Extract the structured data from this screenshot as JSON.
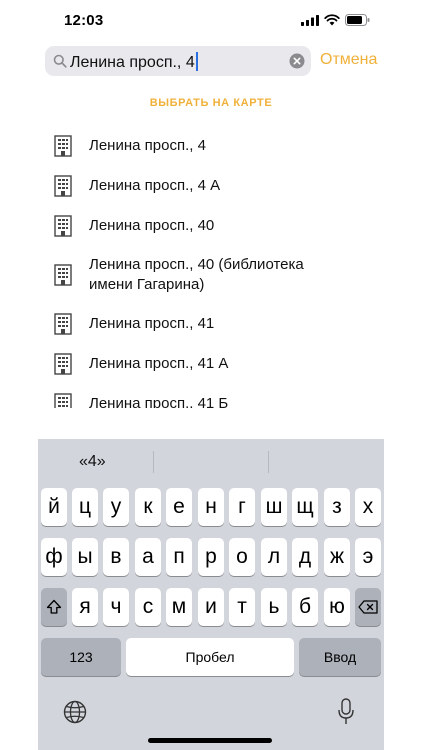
{
  "status_bar": {
    "time": "12:03"
  },
  "search": {
    "query": "Ленина просп., 4",
    "cancel_label": "Отмена"
  },
  "map_link_label": "ВЫБРАТЬ НА КАРТЕ",
  "results": [
    {
      "label": "Ленина просп., 4"
    },
    {
      "label": "Ленина просп., 4 А"
    },
    {
      "label": "Ленина просп., 40"
    },
    {
      "label": "Ленина просп., 40 (библиотека имени Гагарина)"
    },
    {
      "label": "Ленина просп., 41"
    },
    {
      "label": "Ленина просп., 41 А"
    },
    {
      "label": "Ленина просп., 41 Б"
    }
  ],
  "keyboard": {
    "suggestions": [
      "«4»",
      "",
      ""
    ],
    "row1": [
      "й",
      "ц",
      "у",
      "к",
      "е",
      "н",
      "г",
      "ш",
      "щ",
      "з",
      "х"
    ],
    "row2": [
      "ф",
      "ы",
      "в",
      "а",
      "п",
      "р",
      "о",
      "л",
      "д",
      "ж",
      "э"
    ],
    "row3": [
      "я",
      "ч",
      "с",
      "м",
      "и",
      "т",
      "ь",
      "б",
      "ю"
    ],
    "numbers_label": "123",
    "space_label": "Пробел",
    "return_label": "Ввод"
  },
  "icons": {
    "search": "search-icon",
    "clear": "clear-icon",
    "building": "building-icon",
    "shift": "shift-icon",
    "backspace": "backspace-icon",
    "globe": "globe-icon",
    "microphone": "microphone-icon"
  },
  "colors": {
    "accent": "#f0b13a",
    "keyboard_bg": "#d2d5db",
    "search_bg": "#e9e9ed"
  }
}
